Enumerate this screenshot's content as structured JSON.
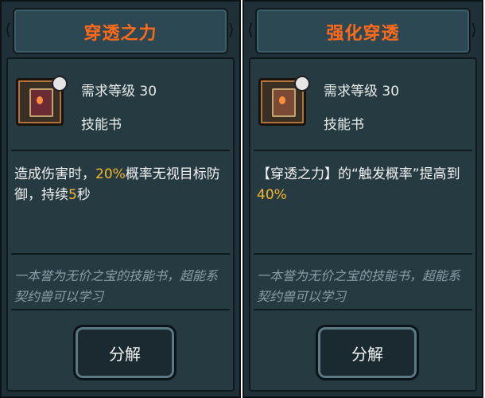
{
  "left_card": {
    "title": "穿透之力",
    "level": "需求等级 30",
    "type": "技能书",
    "desc_prefix": "造成伤害时，",
    "desc_highlight_1": "20%",
    "desc_mid": "概率无视目标防御，持续",
    "desc_highlight_2": "5",
    "desc_suffix": "秒",
    "flavor": "一本誉为无价之宝的技能书，超能系契约兽可以学习",
    "button_label": "分解"
  },
  "right_card": {
    "title": "强化穿透",
    "level": "需求等级 30",
    "type": "技能书",
    "desc_prefix": "【穿透之力】的“触发概率”提高到",
    "desc_highlight": "40%",
    "flavor": "一本誉为无价之宝的技能书，超能系契约兽可以学习",
    "button_label": "分解"
  },
  "colors": {
    "title": "#ff6a1a",
    "highlight": "#f6b62a",
    "panel_bg": "#1f3038"
  },
  "icons": [
    "skill-book-icon",
    "skull-badge-icon"
  ]
}
